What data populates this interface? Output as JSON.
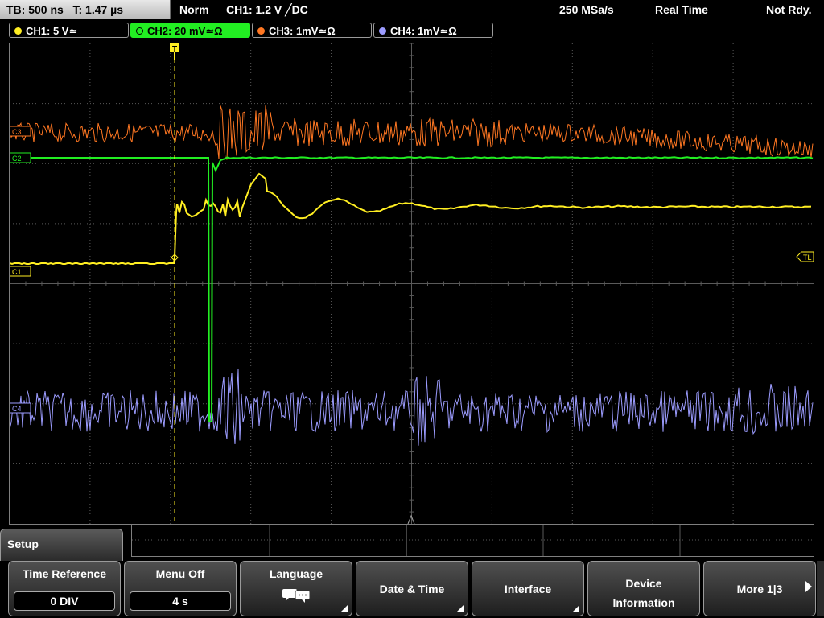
{
  "status": {
    "timebase": "TB: 500 ns",
    "trigger_time": "T: 1.47 µs",
    "trigger_mode": "Norm",
    "trigger_setting": "CH1: 1.2 V ╱DC",
    "sample_rate": "250 MSa/s",
    "acq_mode": "Real Time",
    "state": "Not Rdy."
  },
  "channels": [
    {
      "label": "CH1: 5 V≃",
      "color": "#ffee22"
    },
    {
      "label": "CH2: 20 mV≃Ω",
      "color": "#22ee22"
    },
    {
      "label": "CH3: 1mV≃Ω",
      "color": "#ff7722"
    },
    {
      "label": "CH4: 1mV≃Ω",
      "color": "#9c9cff"
    }
  ],
  "scope": {
    "trigger_marker": "T",
    "ch1_marker": "C1",
    "trigger_level_marker": "TL",
    "ch3_marker": "C3",
    "ch2_marker": "C2",
    "ch4_marker": "C4"
  },
  "menu": {
    "title": "Setup",
    "softkeys": [
      {
        "label": "Time Reference",
        "value": "0 DIV"
      },
      {
        "label": "Menu Off",
        "value": "4 s"
      },
      {
        "label": "Language",
        "value": ""
      },
      {
        "label": "Date & Time",
        "value": ""
      },
      {
        "label": "Interface",
        "value": ""
      },
      {
        "label": "Device Information",
        "value": ""
      },
      {
        "label": "More 1|3",
        "value": ""
      }
    ]
  }
}
